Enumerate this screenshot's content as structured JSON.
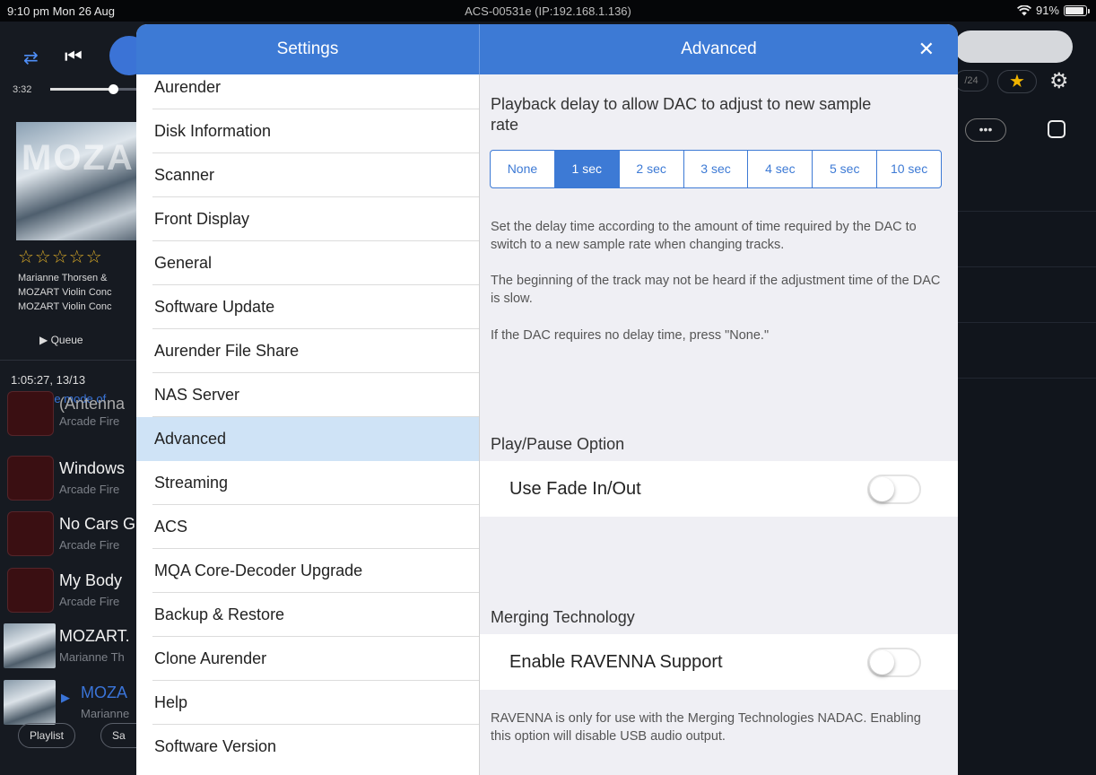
{
  "status_bar": {
    "time": "9:10 pm  Mon 26 Aug",
    "device": "ACS-00531e (IP:192.168.1.136)",
    "wifi_icon": "wifi-icon",
    "battery": "91%",
    "battery_level": 0.91
  },
  "background": {
    "elapsed": "3:32",
    "progress": 0.7,
    "count": "/24",
    "album_text": "MOZART",
    "rating_stars": "☆☆☆☆☆",
    "info": [
      "Marianne Thorsen &",
      "MOZART Violin Conc",
      "MOZART Violin Conc"
    ],
    "queue_label": "Queue",
    "total": "1:05:27, 13/13",
    "consume": "Consume mode of",
    "tracks": [
      {
        "title": "(Antenna",
        "artist": "Arcade Fire"
      },
      {
        "title": "Windows",
        "artist": "Arcade Fire"
      },
      {
        "title": "No Cars G",
        "artist": "Arcade Fire"
      },
      {
        "title": "My Body",
        "artist": "Arcade Fire"
      },
      {
        "title": "MOZART.",
        "artist": "Marianne Th"
      },
      {
        "title": "MOZA",
        "artist": "Marianne"
      }
    ],
    "playlist_label": "Playlist",
    "save_label": "Sa"
  },
  "modal": {
    "left_title": "Settings",
    "right_title": "Advanced",
    "close_label": "✕",
    "menu": [
      "Aurender",
      "Disk Information",
      "Scanner",
      "Front Display",
      "General",
      "Software Update",
      "Aurender File Share",
      "NAS Server",
      "Advanced",
      "Streaming",
      "ACS",
      "MQA Core-Decoder Upgrade",
      "Backup & Restore",
      "Clone Aurender",
      "Help",
      "Software Version"
    ],
    "active_item": "Advanced"
  },
  "advanced": {
    "delay_title": "Playback delay to allow DAC to adjust to new sample rate",
    "delay_options": [
      "None",
      "1 sec",
      "2 sec",
      "3 sec",
      "4 sec",
      "5 sec",
      "10 sec"
    ],
    "delay_selected": "1 sec",
    "delay_desc_1": "Set the delay time according to the amount of time required by the DAC to switch to a new sample rate when changing tracks.",
    "delay_desc_2": "The beginning of the track may not be heard if the adjustment time of the DAC is slow.",
    "delay_desc_3": "If the DAC requires no delay time, press \"None.\"",
    "play_pause_title": "Play/Pause Option",
    "fade_label": "Use Fade In/Out",
    "fade_on": false,
    "merging_title": "Merging Technology",
    "ravenna_label": "Enable RAVENNA Support",
    "ravenna_on": false,
    "ravenna_desc": "RAVENNA is only for use with the Merging Technologies NADAC. Enabling this option will disable USB audio output."
  }
}
